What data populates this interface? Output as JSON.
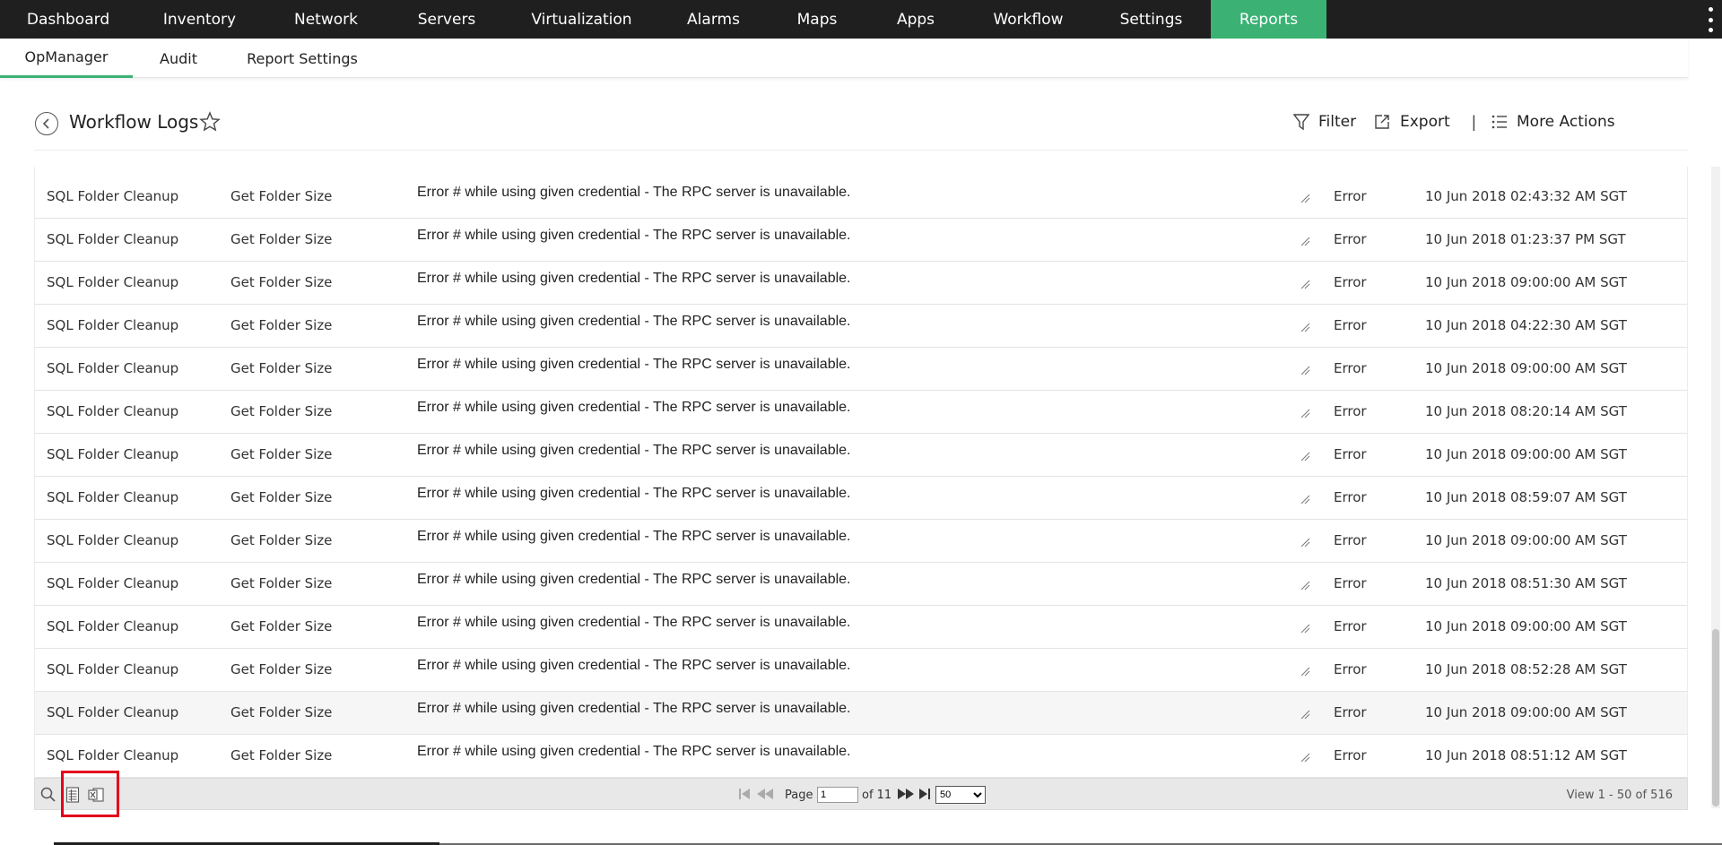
{
  "topnav": {
    "items": [
      {
        "label": "Dashboard"
      },
      {
        "label": "Inventory"
      },
      {
        "label": "Network"
      },
      {
        "label": "Servers"
      },
      {
        "label": "Virtualization"
      },
      {
        "label": "Alarms"
      },
      {
        "label": "Maps"
      },
      {
        "label": "Apps"
      },
      {
        "label": "Workflow"
      },
      {
        "label": "Settings"
      },
      {
        "label": "Reports"
      }
    ],
    "active": "Reports",
    "active_color": "#3bb273",
    "bg_color": "#1f1f1f"
  },
  "subnav": {
    "tabs": [
      {
        "label": "OpManager"
      },
      {
        "label": "Audit"
      },
      {
        "label": "Report Settings"
      }
    ],
    "active": "OpManager"
  },
  "header": {
    "title": "Workflow Logs",
    "filter_label": "Filter",
    "export_label": "Export",
    "separator": "|",
    "more_actions_label": "More Actions"
  },
  "table": {
    "rows": [
      {
        "workflow": "SQL Folder Cleanup",
        "task": "Get Folder Size",
        "message": "Error # while using given credential - The RPC server is unavailable.",
        "status": "Error",
        "time": "10 Jun 2018 02:43:32 AM SGT"
      },
      {
        "workflow": "SQL Folder Cleanup",
        "task": "Get Folder Size",
        "message": "Error # while using given credential - The RPC server is unavailable.",
        "status": "Error",
        "time": "10 Jun 2018 01:23:37 PM SGT"
      },
      {
        "workflow": "SQL Folder Cleanup",
        "task": "Get Folder Size",
        "message": "Error # while using given credential - The RPC server is unavailable.",
        "status": "Error",
        "time": "10 Jun 2018 09:00:00 AM SGT"
      },
      {
        "workflow": "SQL Folder Cleanup",
        "task": "Get Folder Size",
        "message": "Error # while using given credential - The RPC server is unavailable.",
        "status": "Error",
        "time": "10 Jun 2018 04:22:30 AM SGT"
      },
      {
        "workflow": "SQL Folder Cleanup",
        "task": "Get Folder Size",
        "message": "Error # while using given credential - The RPC server is unavailable.",
        "status": "Error",
        "time": "10 Jun 2018 09:00:00 AM SGT"
      },
      {
        "workflow": "SQL Folder Cleanup",
        "task": "Get Folder Size",
        "message": "Error # while using given credential - The RPC server is unavailable.",
        "status": "Error",
        "time": "10 Jun 2018 08:20:14 AM SGT"
      },
      {
        "workflow": "SQL Folder Cleanup",
        "task": "Get Folder Size",
        "message": "Error # while using given credential - The RPC server is unavailable.",
        "status": "Error",
        "time": "10 Jun 2018 09:00:00 AM SGT"
      },
      {
        "workflow": "SQL Folder Cleanup",
        "task": "Get Folder Size",
        "message": "Error # while using given credential - The RPC server is unavailable.",
        "status": "Error",
        "time": "10 Jun 2018 08:59:07 AM SGT"
      },
      {
        "workflow": "SQL Folder Cleanup",
        "task": "Get Folder Size",
        "message": "Error # while using given credential - The RPC server is unavailable.",
        "status": "Error",
        "time": "10 Jun 2018 09:00:00 AM SGT"
      },
      {
        "workflow": "SQL Folder Cleanup",
        "task": "Get Folder Size",
        "message": "Error # while using given credential - The RPC server is unavailable.",
        "status": "Error",
        "time": "10 Jun 2018 08:51:30 AM SGT"
      },
      {
        "workflow": "SQL Folder Cleanup",
        "task": "Get Folder Size",
        "message": "Error # while using given credential - The RPC server is unavailable.",
        "status": "Error",
        "time": "10 Jun 2018 09:00:00 AM SGT"
      },
      {
        "workflow": "SQL Folder Cleanup",
        "task": "Get Folder Size",
        "message": "Error # while using given credential - The RPC server is unavailable.",
        "status": "Error",
        "time": "10 Jun 2018 08:52:28 AM SGT"
      },
      {
        "workflow": "SQL Folder Cleanup",
        "task": "Get Folder Size",
        "message": "Error # while using given credential - The RPC server is unavailable.",
        "status": "Error",
        "time": "10 Jun 2018 09:00:00 AM SGT"
      },
      {
        "workflow": "SQL Folder Cleanup",
        "task": "Get Folder Size",
        "message": "Error # while using given credential - The RPC server is unavailable.",
        "status": "Error",
        "time": "10 Jun 2018 08:51:12 AM SGT"
      }
    ],
    "highlighted_row": 12
  },
  "pager": {
    "page_label": "Page",
    "current_page": "1",
    "of_label": "of 11",
    "page_size_options": [
      "50"
    ],
    "page_size": "50",
    "view_text": "View 1 - 50 of 516",
    "highlight_color": "#e3001b"
  }
}
